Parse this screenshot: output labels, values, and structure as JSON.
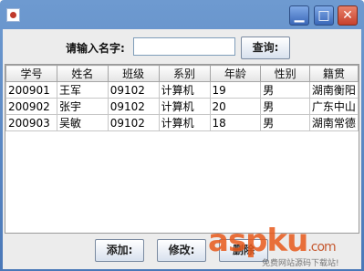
{
  "window": {
    "title": "",
    "minimize_label": "▁",
    "maximize_label": "□",
    "close_label": "✕"
  },
  "search": {
    "label": "请输入名字:",
    "value": "",
    "placeholder": "",
    "button_label": "查询:"
  },
  "table": {
    "columns": [
      "学号",
      "姓名",
      "班级",
      "系别",
      "年龄",
      "性别",
      "籍贯"
    ],
    "rows": [
      [
        "200901",
        "王军",
        "09102",
        "计算机",
        "19",
        "男",
        "湖南衡阳"
      ],
      [
        "200902",
        "张宇",
        "09102",
        "计算机",
        "20",
        "男",
        "广东中山"
      ],
      [
        "200903",
        "吴敏",
        "09102",
        "计算机",
        "18",
        "男",
        "湖南常德"
      ]
    ]
  },
  "buttons": {
    "add_label": "添加:",
    "edit_label": "修改:",
    "delete_label": "删除"
  },
  "watermark": {
    "main": "aspku",
    "suffix": ".com",
    "sub": "免费网站源码下载站!"
  },
  "colors": {
    "title_bar": "#4a78b8",
    "close_button": "#c7412d",
    "watermark": "#e85a1c"
  }
}
